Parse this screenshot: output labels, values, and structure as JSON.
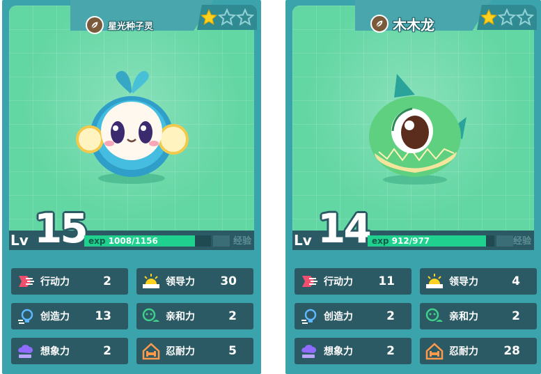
{
  "cards": [
    {
      "name": "星光种子灵",
      "stars_filled": 1,
      "stars_total": 3,
      "level_label": "Lv",
      "level": "15",
      "exp_label": "exp",
      "exp_current": "1008",
      "exp_total": "/1156",
      "exp_fraction": 0.872,
      "exp_button": "经验",
      "stats": [
        {
          "label": "行动力",
          "value": "2",
          "icon": "action-icon"
        },
        {
          "label": "领导力",
          "value": "30",
          "icon": "leadership-icon"
        },
        {
          "label": "创造力",
          "value": "13",
          "icon": "creativity-icon"
        },
        {
          "label": "亲和力",
          "value": "2",
          "icon": "affinity-icon"
        },
        {
          "label": "想象力",
          "value": "2",
          "icon": "imagination-icon"
        },
        {
          "label": "忍耐力",
          "value": "5",
          "icon": "endurance-icon"
        }
      ]
    },
    {
      "name": "木木龙",
      "stars_filled": 1,
      "stars_total": 3,
      "level_label": "Lv",
      "level": "14",
      "exp_label": "exp",
      "exp_current": "912",
      "exp_total": "/977",
      "exp_fraction": 0.933,
      "exp_button": "经验",
      "stats": [
        {
          "label": "行动力",
          "value": "11",
          "icon": "action-icon"
        },
        {
          "label": "领导力",
          "value": "4",
          "icon": "leadership-icon"
        },
        {
          "label": "创造力",
          "value": "2",
          "icon": "creativity-icon"
        },
        {
          "label": "亲和力",
          "value": "2",
          "icon": "affinity-icon"
        },
        {
          "label": "想象力",
          "value": "2",
          "icon": "imagination-icon"
        },
        {
          "label": "忍耐力",
          "value": "28",
          "icon": "endurance-icon"
        }
      ]
    }
  ],
  "colors": {
    "card_frame": "#3aa3ab",
    "art_bg": "#62d6a3",
    "dark_panel": "#2b5a64",
    "exp_fill": "#1fd08f",
    "star_gold": "#ffd21f"
  }
}
